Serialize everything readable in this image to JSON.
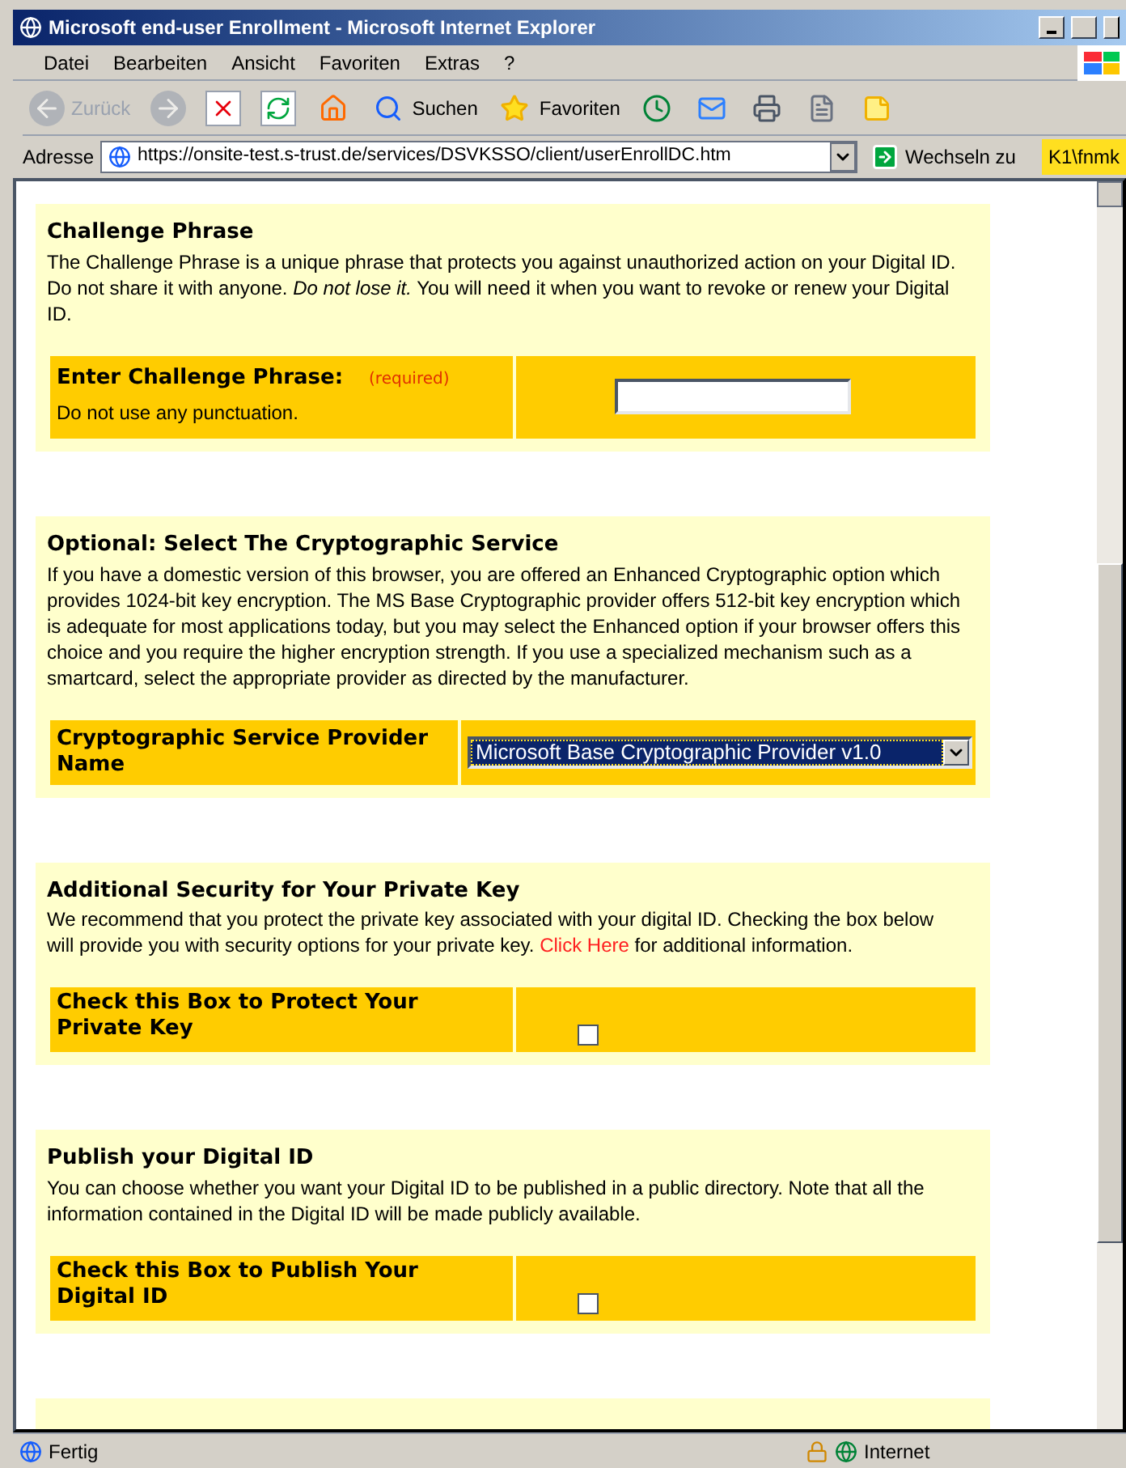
{
  "window": {
    "title": "Microsoft end-user Enrollment - Microsoft Internet Explorer"
  },
  "menu": [
    "Datei",
    "Bearbeiten",
    "Ansicht",
    "Favoriten",
    "Extras",
    "?"
  ],
  "toolbar": [
    {
      "kind": "back",
      "label": "Zurück",
      "disabled": true
    },
    {
      "kind": "forward",
      "disabled": true
    },
    {
      "kind": "stop"
    },
    {
      "kind": "refresh"
    },
    {
      "kind": "home"
    },
    {
      "kind": "search",
      "label": "Suchen"
    },
    {
      "kind": "favorites",
      "label": "Favoriten"
    },
    {
      "kind": "history"
    },
    {
      "kind": "mail"
    },
    {
      "kind": "print"
    },
    {
      "kind": "edit"
    },
    {
      "kind": "note"
    }
  ],
  "address": {
    "label": "Adresse",
    "url": "https://onsite-test.s-trust.de/services/DSVKSSO/client/userEnrollDC.htm",
    "go": "Wechseln zu",
    "user": "K1\\fnmk"
  },
  "sections": [
    {
      "title": "Challenge Phrase",
      "body": "The Challenge Phrase is a unique phrase that protects you against unauthorized action on your Digital ID. Do not share it with anyone. *Do not lose it.* You will need it when you want to revoke or renew your Digital ID.",
      "field": {
        "kind": "text",
        "label": "Enter Challenge Phrase:",
        "required": "(required)",
        "hint": "Do not use any punctuation."
      }
    },
    {
      "title": "Optional: Select The Cryptographic Service",
      "body": "If you have a domestic version of this browser, you are offered an Enhanced Cryptographic option which provides 1024-bit key encryption. The MS Base Cryptographic provider offers 512-bit key encryption which is adequate for most applications today, but you may select the Enhanced option if your browser offers this choice and you require the higher encryption strength. If you use a specialized mechanism such as a smartcard, select the appropriate provider as directed by the manufacturer.",
      "field": {
        "kind": "select",
        "label": "Cryptographic Service Provider Name",
        "value": "Microsoft Base Cryptographic Provider v1.0",
        "focused": true
      }
    },
    {
      "title": "Additional Security for Your Private Key",
      "body": "We recommend that you protect the private key associated with your digital ID. Checking the box below will provide you with security options for your private key.",
      "link": "Click Here",
      "body_after": "for additional information.",
      "field": {
        "kind": "checkbox",
        "label": "Check this Box to Protect Your Private Key",
        "checked": false
      }
    },
    {
      "title": "Publish your Digital ID",
      "body": "You can choose whether you want your Digital ID to be published in a public directory. Note that all the information contained in the Digital ID will be made publicly available.",
      "field": {
        "kind": "checkbox",
        "label": "Check this Box to Publish Your Digital ID",
        "checked": false
      }
    }
  ],
  "status": {
    "text": "Fertig",
    "zone": "Internet"
  }
}
